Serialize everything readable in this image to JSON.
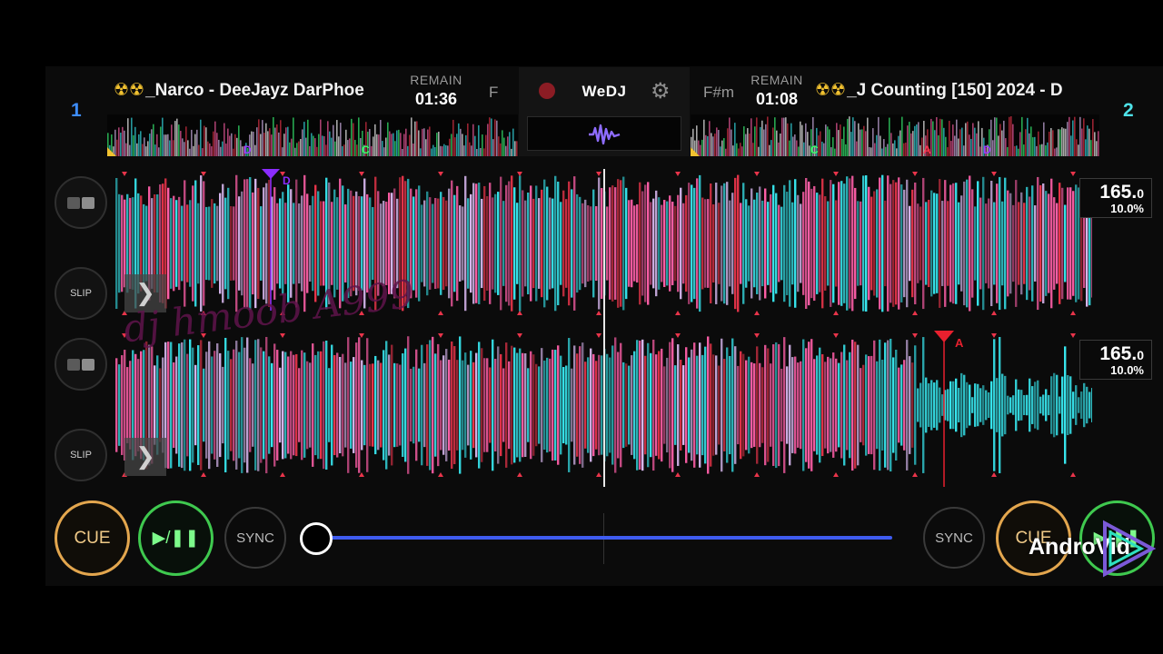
{
  "deck1": {
    "number": "1",
    "title": "_Narco - DeeJayz DarPhoe",
    "remain_label": "REMAIN",
    "remain_time": "01:36",
    "key": "F",
    "bpm": "165.",
    "bpm_decimal": "0",
    "pitch": "10.0%",
    "cue_label": "CUE",
    "play_label": "▶/❚❚",
    "sync_label": "SYNC",
    "slip_label": "SLIP",
    "overview_markers": [
      "D",
      "C"
    ],
    "hot_cue": "D"
  },
  "deck2": {
    "number": "2",
    "title": "_J Counting [150] 2024 - D",
    "remain_label": "REMAIN",
    "remain_time": "01:08",
    "key": "F#m",
    "bpm": "165.",
    "bpm_decimal": "0",
    "pitch": "10.0%",
    "cue_label": "CUE",
    "play_label": "▶/❚❚",
    "sync_label": "SYNC",
    "slip_label": "SLIP",
    "overview_markers": [
      "C",
      "A",
      "D"
    ],
    "hot_cue": "A"
  },
  "header": {
    "brand": "WeDJ",
    "radiation_glyph": "☢☢"
  },
  "crossfader": {
    "position": 0.0
  },
  "overlay": {
    "watermark": "dj hmoob A999",
    "video_watermark": "AndroVid"
  },
  "colors": {
    "deck1_accent": "#3d8dff",
    "deck2_accent": "#4ee2e8",
    "cue": "#e3a64e",
    "play": "#3fc94f",
    "crossfader": "#3f5cf0",
    "wave_pink": "#ff5fa8",
    "wave_cyan": "#37e6ee",
    "wave_lilac": "#d8b8f0",
    "wave_red": "#e8344a"
  },
  "icons": [
    "record-icon",
    "gear-icon",
    "waveform-icon",
    "chevron-right-icon",
    "deck-mode-icon"
  ]
}
